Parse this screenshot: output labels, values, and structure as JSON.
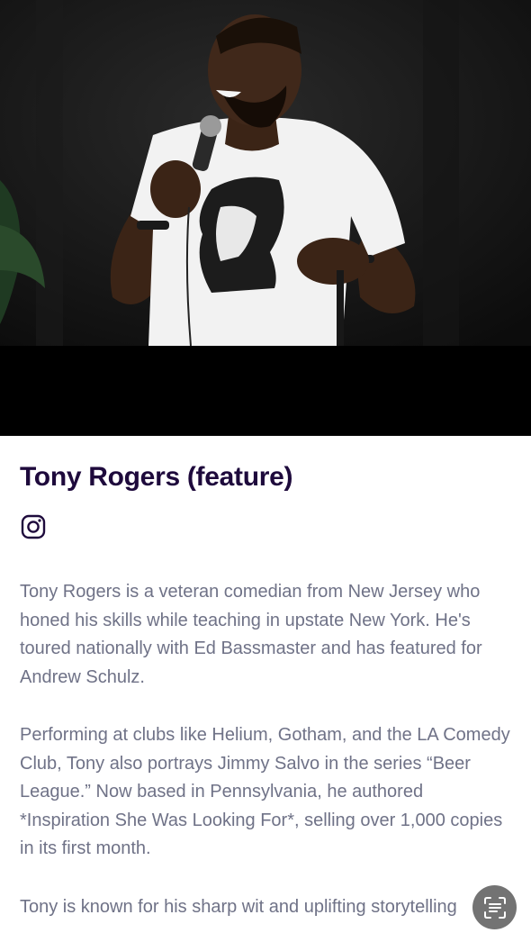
{
  "performer": {
    "name": "Tony Rogers (feature)",
    "photo_icon": "performer-photo",
    "social_icon": "instagram-icon"
  },
  "bio": {
    "p1": "Tony Rogers is a veteran comedian from New Jersey who honed his skills while teaching in upstate New York. He's toured nationally with Ed Bassmaster and has featured for Andrew Schulz.",
    "p2": "Performing at clubs like Helium, Gotham, and the LA Comedy Club, Tony also portrays Jimmy Salvo in the series “Beer League.” Now based in Pennsylvania, he authored *Inspiration She Was Looking For*, selling over 1,000 copies in its first month.",
    "p3": "Tony is known for his sharp wit and uplifting storytelling"
  },
  "floating_button": {
    "icon": "scan-text-icon"
  },
  "colors": {
    "title": "#1e0a3c",
    "body_text": "#6f7287",
    "photo_bg": "#000000"
  }
}
